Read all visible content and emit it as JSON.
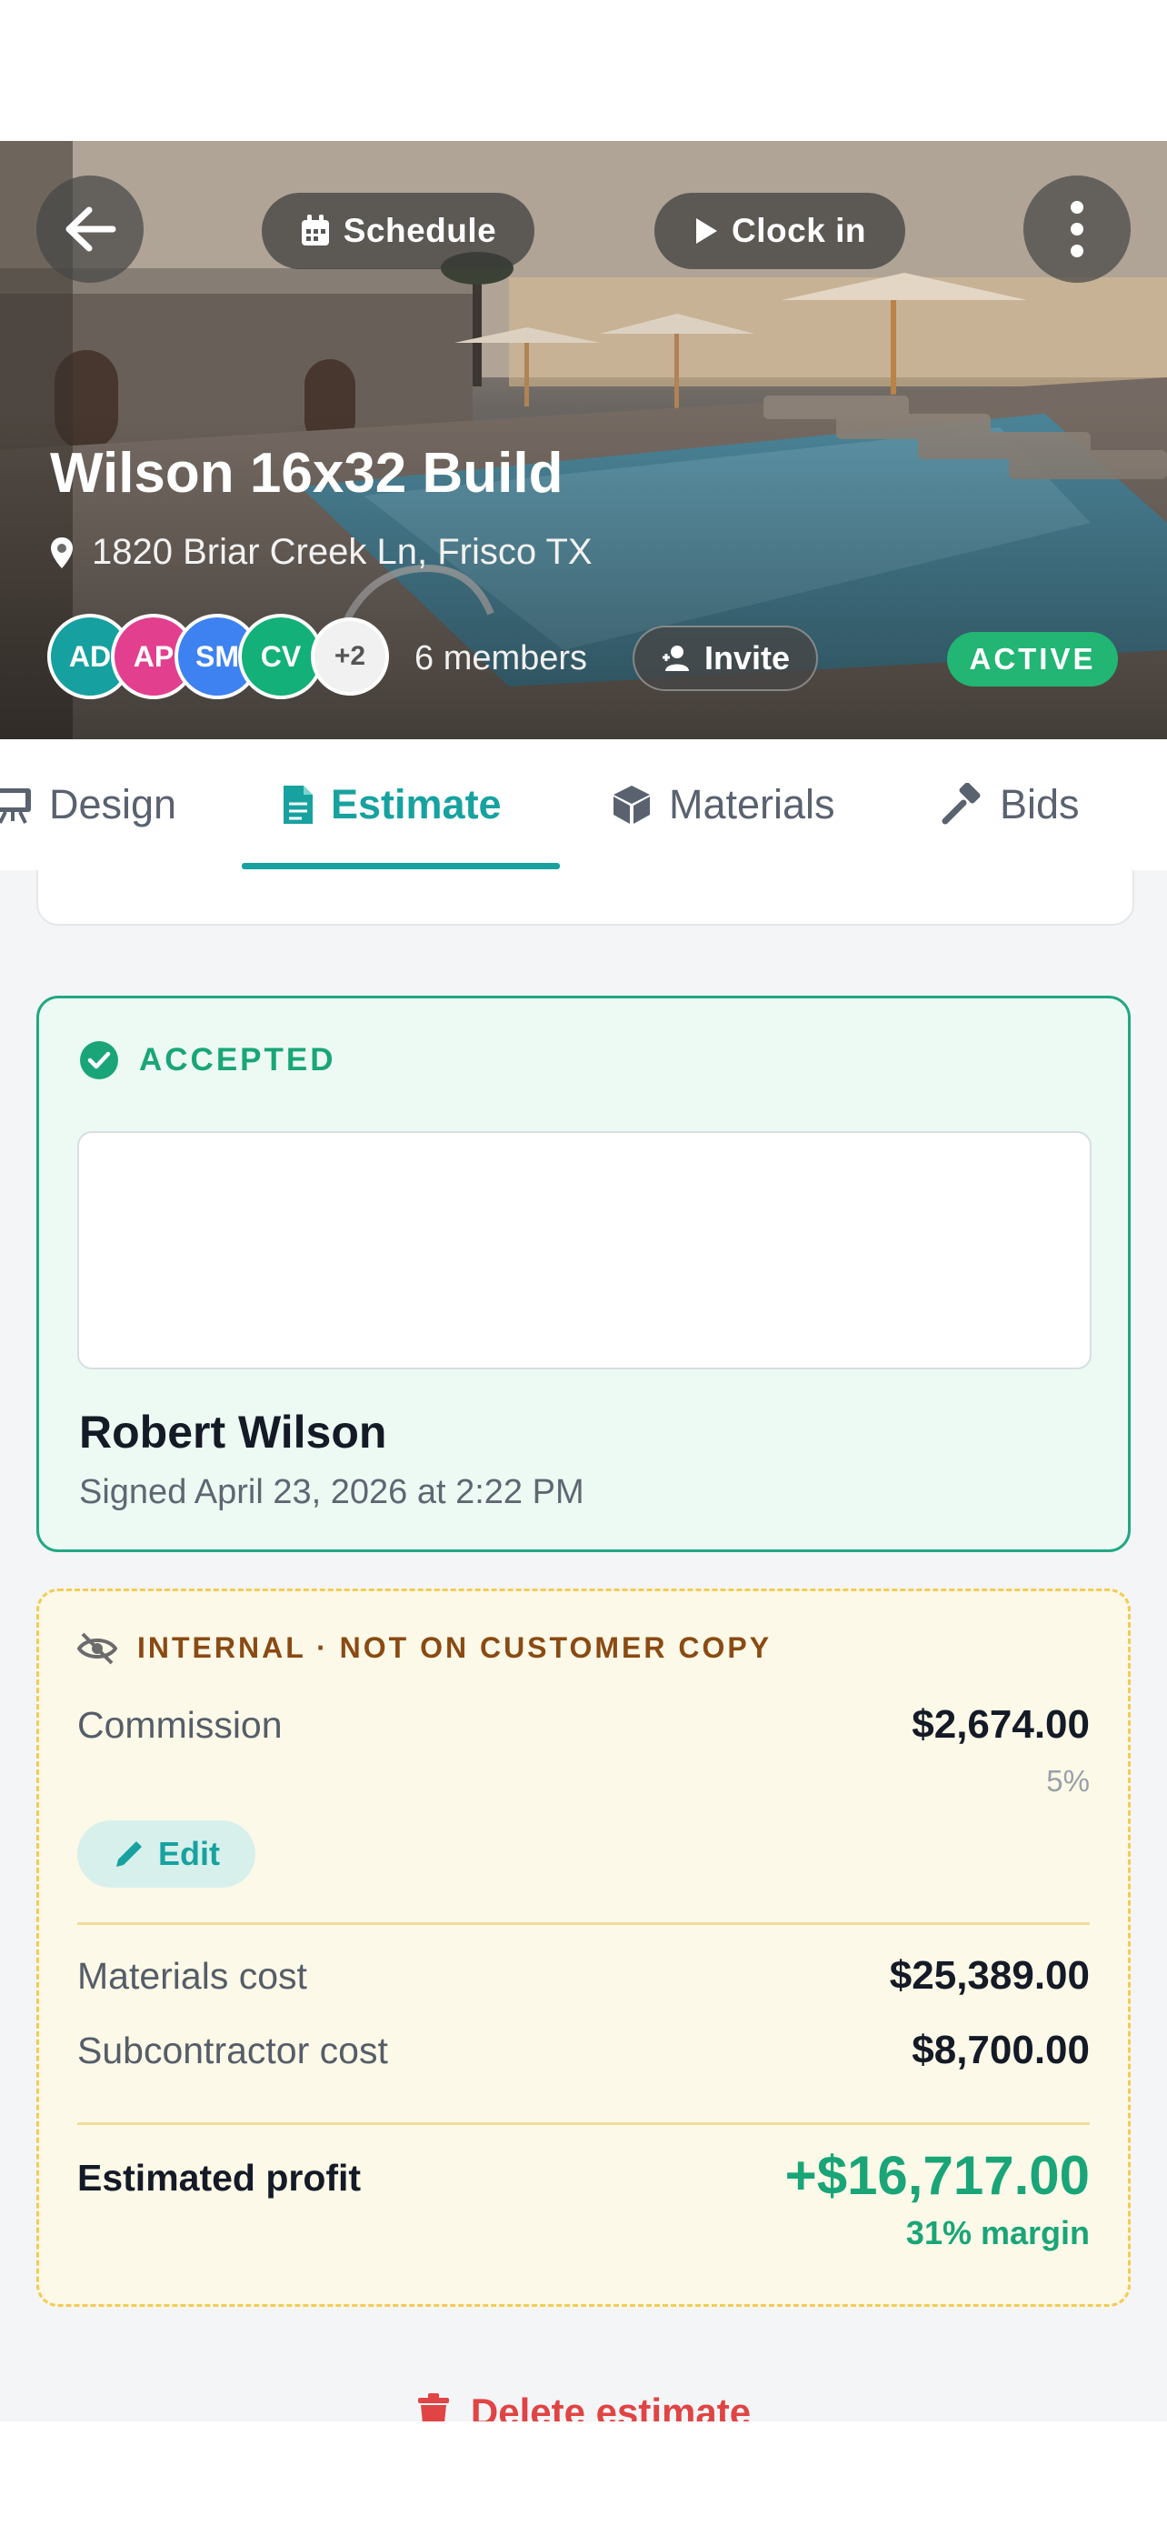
{
  "header": {
    "schedule_label": "Schedule",
    "clock_in_label": "Clock in",
    "project_title": "Wilson 16x32 Build",
    "address": "1820 Briar Creek Ln, Frisco TX",
    "avatars": [
      {
        "initials": "AD",
        "color": "#16a0a0"
      },
      {
        "initials": "AP",
        "color": "#e2408f"
      },
      {
        "initials": "SM",
        "color": "#3d82f0"
      },
      {
        "initials": "CV",
        "color": "#14b07a"
      }
    ],
    "extra_members": "+2",
    "members_label": "6 members",
    "invite_label": "Invite",
    "status": "ACTIVE"
  },
  "tabs": [
    {
      "label": "Design",
      "icon": "easel-icon"
    },
    {
      "label": "Estimate",
      "icon": "document-icon",
      "active": true
    },
    {
      "label": "Materials",
      "icon": "cube-icon"
    },
    {
      "label": "Bids",
      "icon": "hammer-icon"
    }
  ],
  "acceptance": {
    "status": "ACCEPTED",
    "signer_name": "Robert Wilson",
    "signed_text": "Signed April 23, 2026 at 2:22 PM"
  },
  "internal": {
    "heading": "INTERNAL · NOT ON CUSTOMER COPY",
    "commission_label": "Commission",
    "commission_value": "$2,674.00",
    "commission_pct": "5%",
    "edit_label": "Edit",
    "materials_label": "Materials cost",
    "materials_value": "$25,389.00",
    "subcontractor_label": "Subcontractor cost",
    "subcontractor_value": "$8,700.00",
    "profit_label": "Estimated profit",
    "profit_value": "+$16,717.00",
    "margin_text": "31% margin"
  },
  "footer": {
    "delete_label": "Delete estimate"
  },
  "colors": {
    "accent": "#17a2a0",
    "success": "#1aa578",
    "danger": "#e04444",
    "warning_text": "#8a4a13"
  }
}
